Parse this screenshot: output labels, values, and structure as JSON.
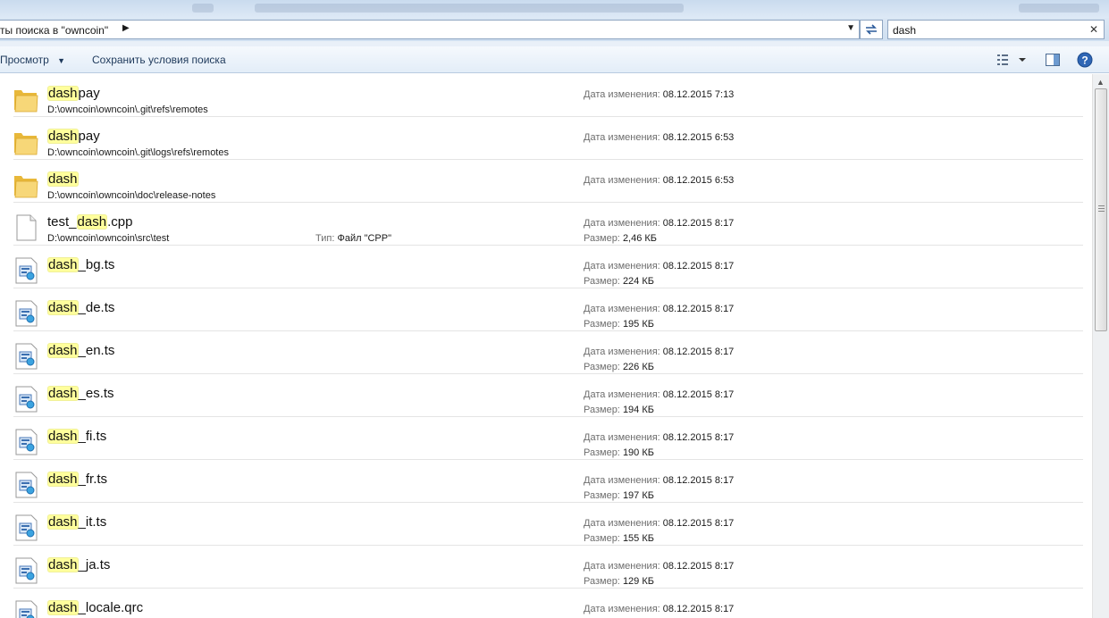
{
  "address": {
    "breadcrumb": "ты поиска в \"owncoin\"",
    "search_value": "dash"
  },
  "toolbar": {
    "view_label": "Просмотр",
    "save_search_label": "Сохранить условия поиска"
  },
  "labels": {
    "date_modified": "Дата изменения:",
    "size": "Размер:",
    "type": "Тип:"
  },
  "files": [
    {
      "kind": "folder",
      "pre": "",
      "hl": "dash",
      "post": "pay",
      "path": "D:\\owncoin\\owncoin\\.git\\refs\\remotes",
      "date": "08.12.2015 7:13",
      "size": "",
      "type": ""
    },
    {
      "kind": "folder",
      "pre": "",
      "hl": "dash",
      "post": "pay",
      "path": "D:\\owncoin\\owncoin\\.git\\logs\\refs\\remotes",
      "date": "08.12.2015 6:53",
      "size": "",
      "type": ""
    },
    {
      "kind": "folder",
      "pre": "",
      "hl": "dash",
      "post": "",
      "path": "D:\\owncoin\\owncoin\\doc\\release-notes",
      "date": "08.12.2015 6:53",
      "size": "",
      "type": ""
    },
    {
      "kind": "file",
      "pre": "test_",
      "hl": "dash",
      "post": ".cpp",
      "path": "D:\\owncoin\\owncoin\\src\\test",
      "date": "08.12.2015 8:17",
      "size": "2,46 КБ",
      "type": "Файл \"CPP\""
    },
    {
      "kind": "ts",
      "pre": "",
      "hl": "dash",
      "post": "_bg.ts",
      "path": "",
      "date": "08.12.2015 8:17",
      "size": "224 КБ",
      "type": ""
    },
    {
      "kind": "ts",
      "pre": "",
      "hl": "dash",
      "post": "_de.ts",
      "path": "",
      "date": "08.12.2015 8:17",
      "size": "195 КБ",
      "type": ""
    },
    {
      "kind": "ts",
      "pre": "",
      "hl": "dash",
      "post": "_en.ts",
      "path": "",
      "date": "08.12.2015 8:17",
      "size": "226 КБ",
      "type": ""
    },
    {
      "kind": "ts",
      "pre": "",
      "hl": "dash",
      "post": "_es.ts",
      "path": "",
      "date": "08.12.2015 8:17",
      "size": "194 КБ",
      "type": ""
    },
    {
      "kind": "ts",
      "pre": "",
      "hl": "dash",
      "post": "_fi.ts",
      "path": "",
      "date": "08.12.2015 8:17",
      "size": "190 КБ",
      "type": ""
    },
    {
      "kind": "ts",
      "pre": "",
      "hl": "dash",
      "post": "_fr.ts",
      "path": "",
      "date": "08.12.2015 8:17",
      "size": "197 КБ",
      "type": ""
    },
    {
      "kind": "ts",
      "pre": "",
      "hl": "dash",
      "post": "_it.ts",
      "path": "",
      "date": "08.12.2015 8:17",
      "size": "155 КБ",
      "type": ""
    },
    {
      "kind": "ts",
      "pre": "",
      "hl": "dash",
      "post": "_ja.ts",
      "path": "",
      "date": "08.12.2015 8:17",
      "size": "129 КБ",
      "type": ""
    },
    {
      "kind": "ts",
      "pre": "",
      "hl": "dash",
      "post": "_locale.qrc",
      "path": "",
      "date": "08.12.2015 8:17",
      "size": "",
      "type": ""
    }
  ],
  "icons": {
    "folder": "folder-icon",
    "file": "blank-file-icon",
    "ts": "qt-translation-file-icon",
    "view": "view-options-icon",
    "preview": "preview-pane-icon",
    "help": "help-icon",
    "refresh": "refresh-icon"
  },
  "colors": {
    "highlight": "#ffff9c",
    "folder": "#f2c84b",
    "accent": "#1e395b"
  }
}
